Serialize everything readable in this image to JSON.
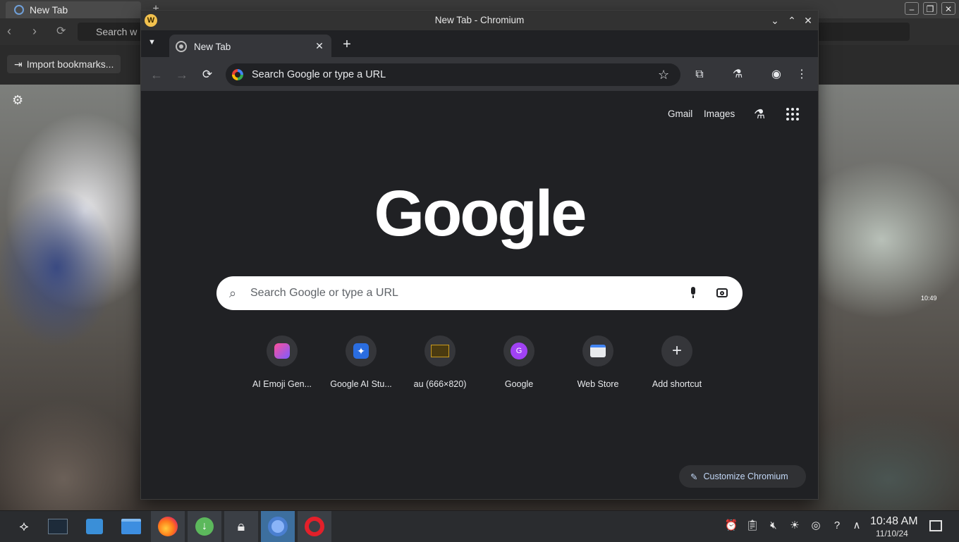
{
  "background_window": {
    "tab_title": "New Tab",
    "search_placeholder": "Search w",
    "import_bookmarks": "Import bookmarks...",
    "desktop_clock": "10:49"
  },
  "chromium": {
    "window_title": "New Tab - Chromium",
    "tab_title": "New Tab",
    "omnibox_placeholder": "Search Google or type a URL",
    "top_links": {
      "gmail": "Gmail",
      "images": "Images"
    },
    "logo_text": "Google",
    "search_placeholder": "Search Google or type a URL",
    "shortcuts": [
      {
        "label": "AI Emoji Gen...",
        "icon": "emoji-icon",
        "color": "#ff4f9a"
      },
      {
        "label": "Google AI Stu...",
        "icon": "ai-studio-icon",
        "color": "#2a6de0"
      },
      {
        "label": "au (666×820)",
        "icon": "image-thumbnail-icon",
        "color": "#c99a1e"
      },
      {
        "label": "Google",
        "icon": "letter-g-icon",
        "color": "#a142f4"
      },
      {
        "label": "Web Store",
        "icon": "web-store-icon",
        "color": "#4285f4"
      },
      {
        "label": "Add shortcut",
        "icon": "plus-icon",
        "color": "#e8eaed"
      }
    ],
    "customize_label": "Customize Chromium"
  },
  "taskbar": {
    "apps": [
      "app-launcher-icon",
      "task-manager-icon",
      "store-icon",
      "file-manager-icon",
      "firefox-icon",
      "downloader-icon",
      "lock-icon",
      "chromium-icon",
      "opera-icon"
    ],
    "time": "10:48 AM",
    "date": "11/10/24"
  }
}
